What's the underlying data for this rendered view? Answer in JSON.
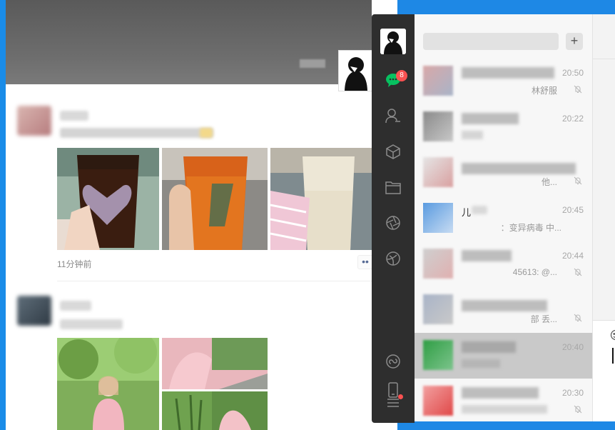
{
  "moments": {
    "post1": {
      "time": "11分钟前",
      "more": "••"
    }
  },
  "sidebar": {
    "badge_count": "8",
    "icons": [
      "chat-icon",
      "contacts-icon",
      "favorites-icon",
      "files-icon",
      "moments-icon",
      "channels-icon",
      "mini-programs-icon",
      "phone-icon",
      "menu-icon"
    ]
  },
  "chatlist": {
    "search_placeholder": "",
    "add_label": "+",
    "chats": [
      {
        "time": "20:50",
        "preview": "林舒服",
        "muted": true
      },
      {
        "time": "20:22",
        "preview": "",
        "muted": false
      },
      {
        "time": "",
        "preview": "他...",
        "muted": true
      },
      {
        "time": "20:45",
        "name": "儿",
        "preview": "：变异病毒      中...",
        "muted": false
      },
      {
        "time": "20:44",
        "preview": "45613: @...",
        "muted": true
      },
      {
        "time": "",
        "preview": "部   丢...",
        "muted": true
      },
      {
        "time": "20:40",
        "preview": "",
        "muted": false,
        "selected": true
      },
      {
        "time": "20:30",
        "preview": "",
        "muted": true
      }
    ]
  },
  "colors": {
    "accent_green": "#07c160",
    "badge_red": "#fa5151",
    "sidebar_bg": "#2e2e2e"
  }
}
